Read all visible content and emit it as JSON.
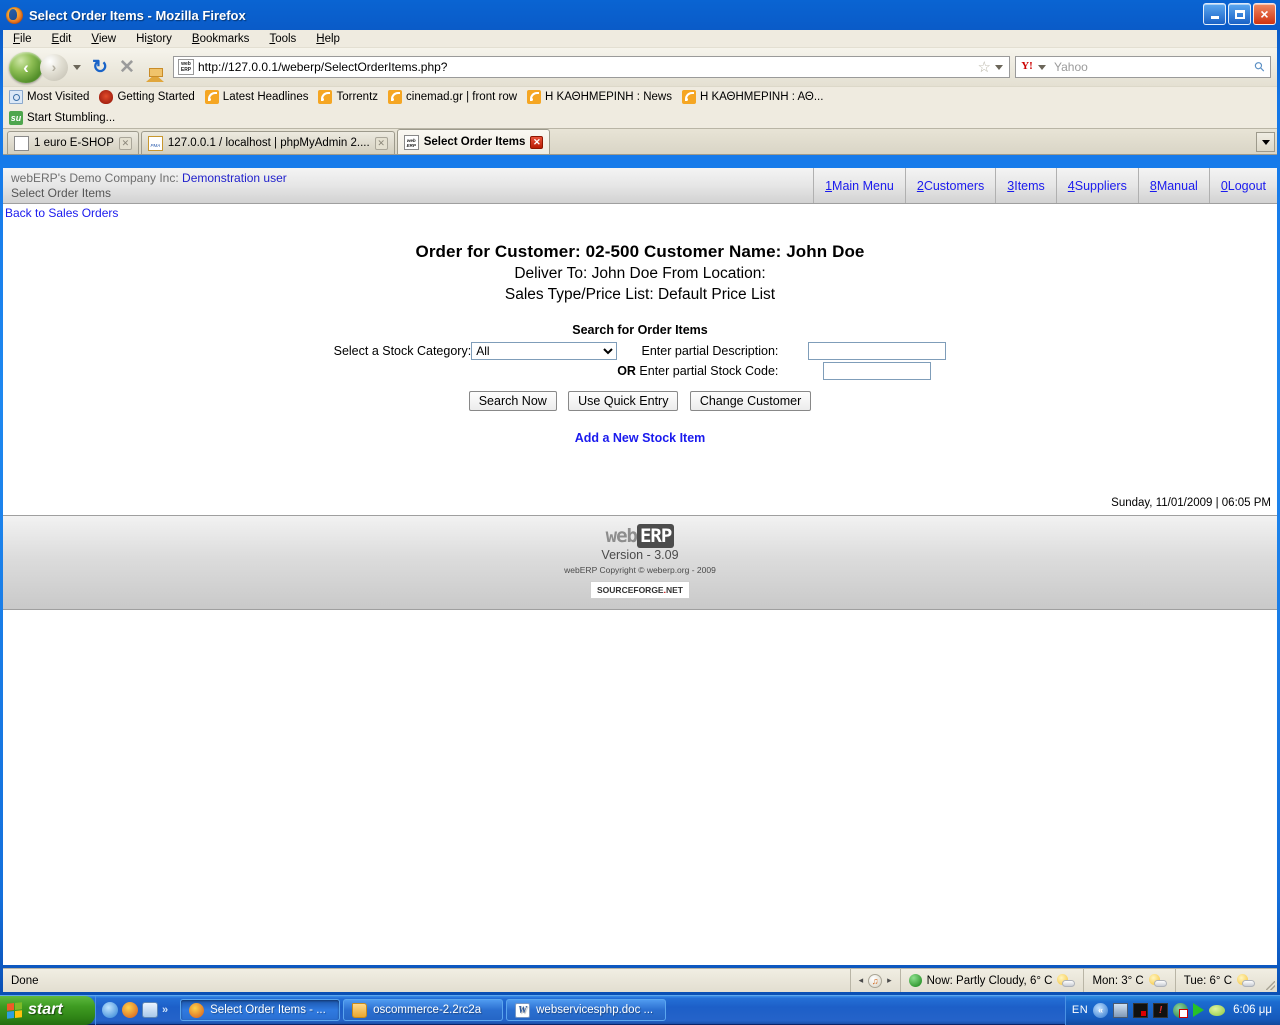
{
  "window": {
    "title": "Select Order Items - Mozilla Firefox",
    "minimize_label": "Minimize",
    "maximize_label": "Maximize",
    "close_label": "Close"
  },
  "menubar": [
    {
      "label": "File",
      "accel": "F"
    },
    {
      "label": "Edit",
      "accel": "E"
    },
    {
      "label": "View",
      "accel": "V"
    },
    {
      "label": "History",
      "accel": "H"
    },
    {
      "label": "Bookmarks",
      "accel": "B"
    },
    {
      "label": "Tools",
      "accel": "T"
    },
    {
      "label": "Help",
      "accel": "H"
    }
  ],
  "navbar": {
    "back_glyph": "‹",
    "forward_glyph": "›",
    "reload_glyph": "↻",
    "stop_glyph": "✕",
    "url": "http://127.0.0.1/weberp/SelectOrderItems.php?",
    "favicon_text": "web ERP",
    "star_glyph": "☆",
    "search_engine": "Y!",
    "search_placeholder": "Yahoo",
    "search_value": "",
    "search_glyph": "⚲"
  },
  "bookmarks_row1": [
    {
      "label": "Most Visited",
      "icon": "most-visited-icon"
    },
    {
      "label": "Getting Started",
      "icon": "firefox-getting-started-icon"
    },
    {
      "label": "Latest Headlines",
      "icon": "rss-feed-icon"
    },
    {
      "label": "Torrentz",
      "icon": "rss-feed-icon"
    },
    {
      "label": "cinemad.gr | front row",
      "icon": "rss-feed-icon"
    },
    {
      "label": "Η ΚΑΘΗΜΕΡΙΝΗ : News",
      "icon": "rss-feed-icon"
    },
    {
      "label": "Η ΚΑΘΗΜΕΡΙΝΗ : ΑΘ...",
      "icon": "rss-feed-icon"
    }
  ],
  "bookmarks_row2": [
    {
      "label": "Start Stumbling...",
      "icon": "stumbleupon-icon"
    }
  ],
  "tabs": [
    {
      "label": "1 euro E-SHOP",
      "icon": "generic-page-icon",
      "active": false
    },
    {
      "label": "127.0.0.1 / localhost | phpMyAdmin 2....",
      "icon": "phpmyadmin-icon",
      "active": false
    },
    {
      "label": "Select Order Items",
      "icon": "weberp-icon",
      "active": true
    }
  ],
  "tab_close_glyph": "✕",
  "tab_list_label": "List all tabs",
  "erp": {
    "company": "webERP's Demo Company Inc:",
    "user": "Demonstration user",
    "page_name": "Select Order Items",
    "back_link": "Back to Sales Orders",
    "nav": [
      {
        "key": "1",
        "label": " Main Menu"
      },
      {
        "key": "2",
        "label": " Customers"
      },
      {
        "key": "3",
        "label": " Items"
      },
      {
        "key": "4",
        "label": " Suppliers"
      },
      {
        "key": "8",
        "label": " Manual"
      },
      {
        "key": "0",
        "label": " Logout"
      }
    ]
  },
  "order": {
    "title": "Order for Customer: 02-500  Customer Name: John Doe",
    "deliver_to": "Deliver To: John Doe  From Location:",
    "sales_type": "Sales Type/Price List: Default Price List"
  },
  "search": {
    "heading": "Search for Order Items",
    "category_label": "Select a Stock Category:",
    "category_selected": "All",
    "category_options": [
      "All"
    ],
    "description_label": "Enter partial Description:",
    "description_value": "",
    "or_label": "OR",
    "stockcode_label": "Enter partial Stock Code:",
    "stockcode_value": "",
    "buttons": [
      {
        "label": "Search Now",
        "name": "search-now-button"
      },
      {
        "label": "Use Quick Entry",
        "name": "use-quick-entry-button"
      },
      {
        "label": "Change Customer",
        "name": "change-customer-button"
      }
    ],
    "add_new_item_link": "Add a New Stock Item"
  },
  "datestamp": "Sunday, 11/01/2009 | 06:05 PM",
  "footer": {
    "logo_part1": "web",
    "logo_part2": "ERP",
    "version": "Version - 3.09",
    "copyright": "webERP Copyright © weberp.org - 2009",
    "sourceforge_a": "SOURCEFORGE",
    "sourceforge_dot": ".",
    "sourceforge_b": "NET"
  },
  "statusbar": {
    "status": "Done",
    "music_prev": "◂",
    "music_next": "▸",
    "music_note": "♫",
    "weather_now": "Now: Partly Cloudy, 6° C",
    "weather_mon": "Mon: 3° C",
    "weather_tue": "Tue: 6° C"
  },
  "taskbar": {
    "start_label": "start",
    "quicklaunch_chevron": "»",
    "tasks": [
      {
        "label": "Select Order Items - ...",
        "icon": "firefox-icon",
        "active": true
      },
      {
        "label": "oscommerce-2.2rc2a",
        "icon": "folder-icon",
        "active": false
      },
      {
        "label": "webservicesphp.doc ...",
        "icon": "word-document-icon",
        "active": false
      }
    ],
    "language": "EN",
    "tray_chevron": "«",
    "clock": "6:06 μμ"
  },
  "colors": {
    "title_blue": "#1E88F0",
    "link_blue": "#1a1aee",
    "chrome_beige": "#EDEADF",
    "taskbar_blue": "#2563c9",
    "start_green": "#3f9c22"
  }
}
